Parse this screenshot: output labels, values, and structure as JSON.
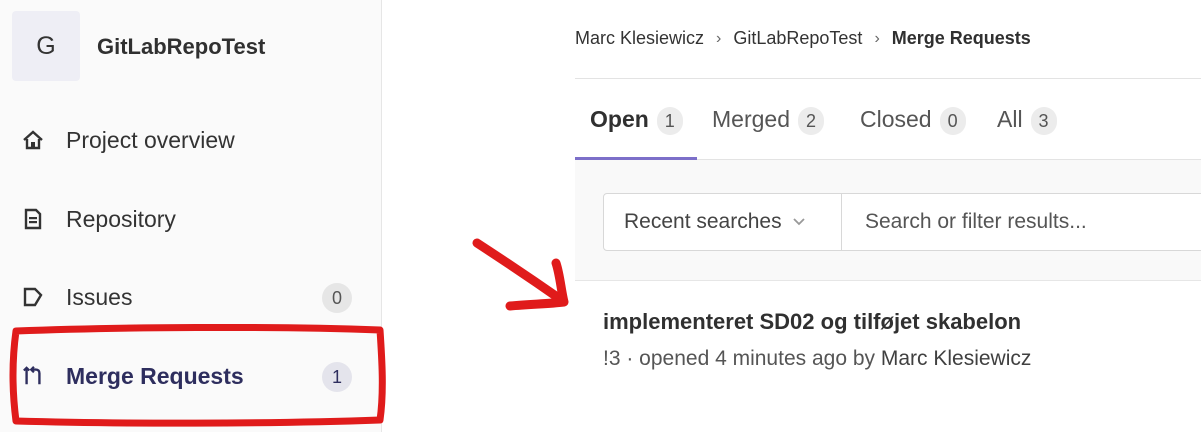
{
  "sidebar": {
    "project": {
      "avatar_letter": "G",
      "name": "GitLabRepoTest"
    },
    "items": [
      {
        "label": "Project overview",
        "icon": "home-icon"
      },
      {
        "label": "Repository",
        "icon": "file-icon"
      },
      {
        "label": "Issues",
        "icon": "issues-icon",
        "count": "0"
      },
      {
        "label": "Merge Requests",
        "icon": "merge-request-icon",
        "count": "1",
        "active": true
      }
    ]
  },
  "breadcrumb": {
    "items": [
      "Marc Klesiewicz",
      "GitLabRepoTest"
    ],
    "current": "Merge Requests",
    "separator": "›"
  },
  "tabs": [
    {
      "label": "Open",
      "count": "1",
      "active": true
    },
    {
      "label": "Merged",
      "count": "2"
    },
    {
      "label": "Closed",
      "count": "0"
    },
    {
      "label": "All",
      "count": "3"
    }
  ],
  "filter": {
    "recent_label": "Recent searches",
    "search_placeholder": "Search or filter results..."
  },
  "merge_request": {
    "title": "implementeret SD02 og tilføjet skabelon",
    "meta_prefix": "!3 · opened 4 minutes ago by ",
    "author": "Marc Klesiewicz"
  },
  "colors": {
    "accent": "#7c6fc9",
    "annotation": "#e01b1b"
  }
}
